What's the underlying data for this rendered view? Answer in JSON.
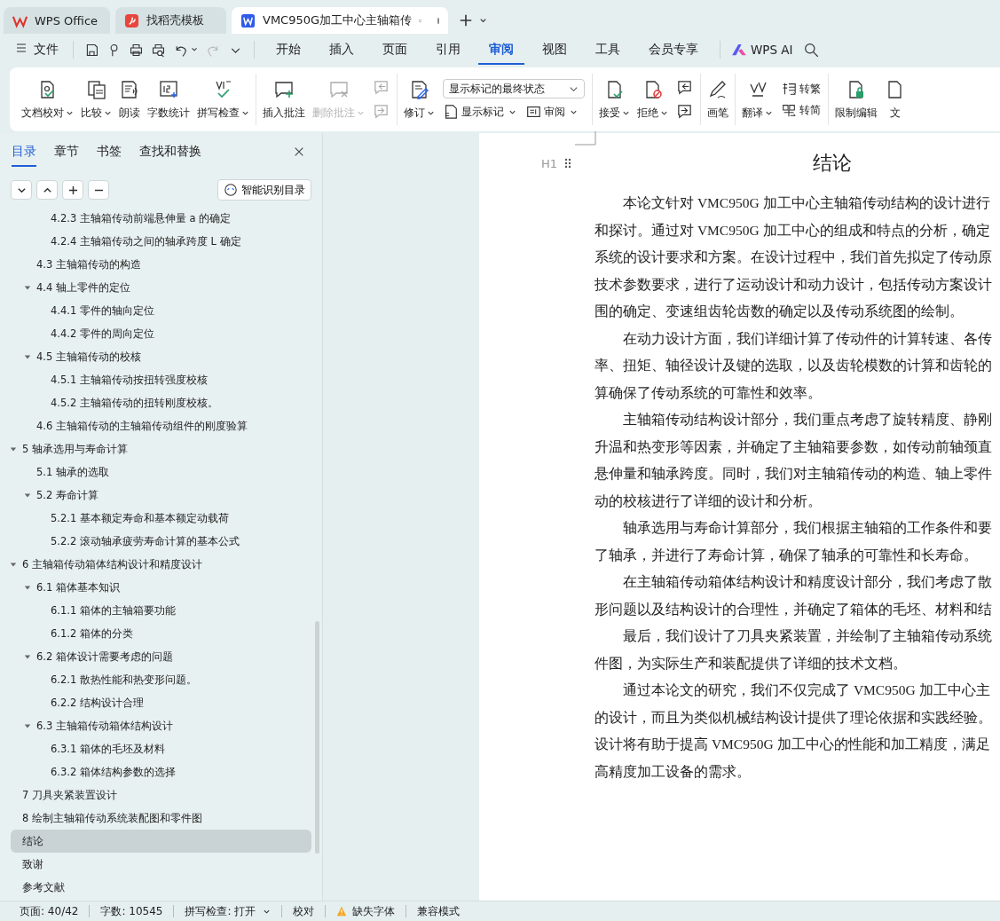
{
  "tabs": [
    {
      "label": "WPS Office",
      "kind": "home",
      "selected": false
    },
    {
      "label": "找稻壳模板",
      "kind": "template",
      "selected": false
    },
    {
      "label": "VMC950G加工中心主轴箱传",
      "kind": "doc",
      "selected": true
    }
  ],
  "menu": {
    "file": "文件",
    "items": [
      {
        "label": "开始",
        "selected": false
      },
      {
        "label": "插入",
        "selected": false
      },
      {
        "label": "页面",
        "selected": false
      },
      {
        "label": "引用",
        "selected": false
      },
      {
        "label": "审阅",
        "selected": true
      },
      {
        "label": "视图",
        "selected": false
      },
      {
        "label": "工具",
        "selected": false
      },
      {
        "label": "会员专享",
        "selected": false
      }
    ],
    "ai": "WPS AI"
  },
  "ribbon": [
    {
      "items": [
        {
          "kind": "big",
          "label": "文档校对",
          "dropdown": true,
          "disabled": false
        },
        {
          "kind": "big",
          "label": "比较",
          "dropdown": true,
          "disabled": false
        },
        {
          "kind": "big",
          "label": "朗读",
          "dropdown": false,
          "disabled": false
        },
        {
          "kind": "big",
          "label": "字数统计",
          "dropdown": false,
          "disabled": false
        },
        {
          "kind": "big",
          "label": "拼写检查",
          "dropdown": true,
          "disabled": false
        }
      ]
    },
    {
      "items": [
        {
          "kind": "big",
          "label": "插入批注",
          "dropdown": false,
          "disabled": false
        },
        {
          "kind": "big",
          "label": "删除批注",
          "dropdown": true,
          "disabled": true
        },
        {
          "kind": "iconpair",
          "disabled": true
        }
      ]
    },
    {
      "items": [
        {
          "kind": "big",
          "label": "修订",
          "dropdown": true,
          "disabled": false
        },
        {
          "kind": "stack",
          "rows": [
            {
              "kind": "select",
              "value": "显示标记的最终状态"
            },
            {
              "kind": "pair",
              "buttons": [
                {
                  "label": "显示标记",
                  "dropdown": true
                },
                {
                  "label": "审阅",
                  "dropdown": true
                }
              ]
            }
          ]
        }
      ]
    },
    {
      "items": [
        {
          "kind": "big",
          "label": "接受",
          "dropdown": true,
          "disabled": false
        },
        {
          "kind": "big",
          "label": "拒绝",
          "dropdown": true,
          "disabled": false
        },
        {
          "kind": "iconpair",
          "disabled": false
        }
      ]
    },
    {
      "items": [
        {
          "kind": "big",
          "label": "画笔",
          "dropdown": false,
          "disabled": false
        }
      ]
    },
    {
      "items": [
        {
          "kind": "big",
          "label": "翻译",
          "dropdown": true,
          "disabled": false
        },
        {
          "kind": "stack",
          "rows": [
            {
              "kind": "pair",
              "buttons": [
                {
                  "label": "转繁",
                  "dropdown": false
                }
              ]
            },
            {
              "kind": "pair",
              "buttons": [
                {
                  "label": "转简",
                  "dropdown": false
                }
              ]
            }
          ]
        }
      ]
    },
    {
      "items": [
        {
          "kind": "big",
          "label": "限制编辑",
          "dropdown": false,
          "disabled": false
        },
        {
          "kind": "big",
          "label": "文",
          "dropdown": false,
          "disabled": false
        }
      ]
    }
  ],
  "sidebar": {
    "tabs": [
      {
        "label": "目录",
        "selected": true
      },
      {
        "label": "章节",
        "selected": false
      },
      {
        "label": "书签",
        "selected": false
      },
      {
        "label": "查找和替换",
        "selected": false
      }
    ],
    "smart_button": "智能识别目录",
    "toc": [
      {
        "children": [
          {
            "children": [
              {
                "label": "4.2.3 主轴箱传动前端悬伸量 a 的确定",
                "selected": false
              },
              {
                "label": "4.2.4  主轴箱传动之间的轴承跨度 L 确定",
                "selected": false
              }
            ]
          },
          {
            "label": "4.3    主轴箱传动的构造",
            "selected": false
          },
          {
            "label": "4.4    轴上零件的定位",
            "selected": false,
            "expanded": true,
            "children": [
              {
                "label": "4.4.1 零件的轴向定位",
                "selected": false
              },
              {
                "label": "4.4.2 零件的周向定位",
                "selected": false
              }
            ]
          },
          {
            "label": "4.5    主轴箱传动的校核",
            "selected": false,
            "expanded": true,
            "children": [
              {
                "label": "4.5.1 主轴箱传动按扭转强度校核",
                "selected": false
              },
              {
                "label": "4.5.2 主轴箱传动的扭转刚度校核。",
                "selected": false
              }
            ]
          },
          {
            "label": "4.6    主轴箱传动的主轴箱传动组件的刚度验算",
            "selected": false
          }
        ]
      },
      {
        "label": "5  轴承选用与寿命计算",
        "selected": false,
        "expanded": true,
        "children": [
          {
            "label": "5.1  轴承的选取",
            "selected": false
          },
          {
            "label": "5.2  寿命计算",
            "selected": false,
            "expanded": true,
            "children": [
              {
                "label": "5.2.1  基本额定寿命和基本额定动载荷",
                "selected": false
              },
              {
                "label": "5.2.2  滚动轴承疲劳寿命计算的基本公式",
                "selected": false
              }
            ]
          }
        ]
      },
      {
        "label": "6 主轴箱传动箱体结构设计和精度设计",
        "selected": false,
        "expanded": true,
        "children": [
          {
            "label": "6.1  箱体基本知识",
            "selected": false,
            "expanded": true,
            "children": [
              {
                "label": "6.1.1 箱体的主轴箱要功能",
                "selected": false
              },
              {
                "label": "6.1.2 箱体的分类",
                "selected": false
              }
            ]
          },
          {
            "label": "6.2  箱体设计需要考虑的问题",
            "selected": false,
            "expanded": true,
            "children": [
              {
                "label": "6.2.1 散热性能和热变形问题。",
                "selected": false
              },
              {
                "label": "6.2.2 结构设计合理",
                "selected": false
              }
            ]
          },
          {
            "label": "6.3  主轴箱传动箱体结构设计",
            "selected": false,
            "expanded": true,
            "children": [
              {
                "label": "6.3.1 箱体的毛坯及材料",
                "selected": false
              },
              {
                "label": "6.3.2 箱体结构参数的选择",
                "selected": false
              }
            ]
          }
        ]
      },
      {
        "label": "7 刀具夹紧装置设计",
        "selected": false
      },
      {
        "label": "8 绘制主轴箱传动系统装配图和零件图",
        "selected": false
      },
      {
        "label": "结论",
        "selected": true
      },
      {
        "label": "致谢",
        "selected": false
      },
      {
        "label": "参考文献",
        "selected": false
      }
    ]
  },
  "document": {
    "heading_marker": "H1",
    "title": "结论",
    "paragraphs": [
      {
        "lines": [
          "本论文针对 VMC950G 加工中心主轴箱传动结构的设计进行",
          "和探讨。通过对 VMC950G 加工中心的组成和特点的分析，确定",
          "系统的设计要求和方案。在设计过程中，我们首先拟定了传动原",
          "技术参数要求，进行了运动设计和动力设计，包括传动方案设计",
          "围的确定、变速组齿轮齿数的确定以及传动系统图的绘制。"
        ]
      },
      {
        "lines": [
          "在动力设计方面，我们详细计算了传动件的计算转速、各传",
          "率、扭矩、轴径设计及键的选取，以及齿轮模数的计算和齿轮的",
          "算确保了传动系统的可靠性和效率。"
        ]
      },
      {
        "lines": [
          "主轴箱传动结构设计部分，我们重点考虑了旋转精度、静刚",
          "升温和热变形等因素，并确定了主轴箱要参数，如传动前轴颈直",
          "悬伸量和轴承跨度。同时，我们对主轴箱传动的构造、轴上零件",
          "动的校核进行了详细的设计和分析。"
        ]
      },
      {
        "lines": [
          "轴承选用与寿命计算部分，我们根据主轴箱的工作条件和要",
          "了轴承，并进行了寿命计算，确保了轴承的可靠性和长寿命。"
        ]
      },
      {
        "lines": [
          "在主轴箱传动箱体结构设计和精度设计部分，我们考虑了散",
          "形问题以及结构设计的合理性，并确定了箱体的毛坯、材料和结"
        ]
      },
      {
        "lines": [
          "最后，我们设计了刀具夹紧装置，并绘制了主轴箱传动系统",
          "件图，为实际生产和装配提供了详细的技术文档。"
        ]
      },
      {
        "lines": [
          "通过本论文的研究，我们不仅完成了 VMC950G 加工中心主",
          "的设计，而且为类似机械结构设计提供了理论依据和实践经验。",
          "设计将有助于提高 VMC950G 加工中心的性能和加工精度，满足",
          "高精度加工设备的需求。"
        ]
      }
    ]
  },
  "status_bar": [
    {
      "kind": "text",
      "label": "页面: 40/42"
    },
    {
      "kind": "text",
      "label": "字数: 10545"
    },
    {
      "kind": "dropdown",
      "label": "拼写检查: 打开"
    },
    {
      "kind": "text",
      "label": "校对"
    },
    {
      "kind": "warning",
      "label": "缺失字体"
    },
    {
      "kind": "text",
      "label": "兼容模式"
    }
  ]
}
